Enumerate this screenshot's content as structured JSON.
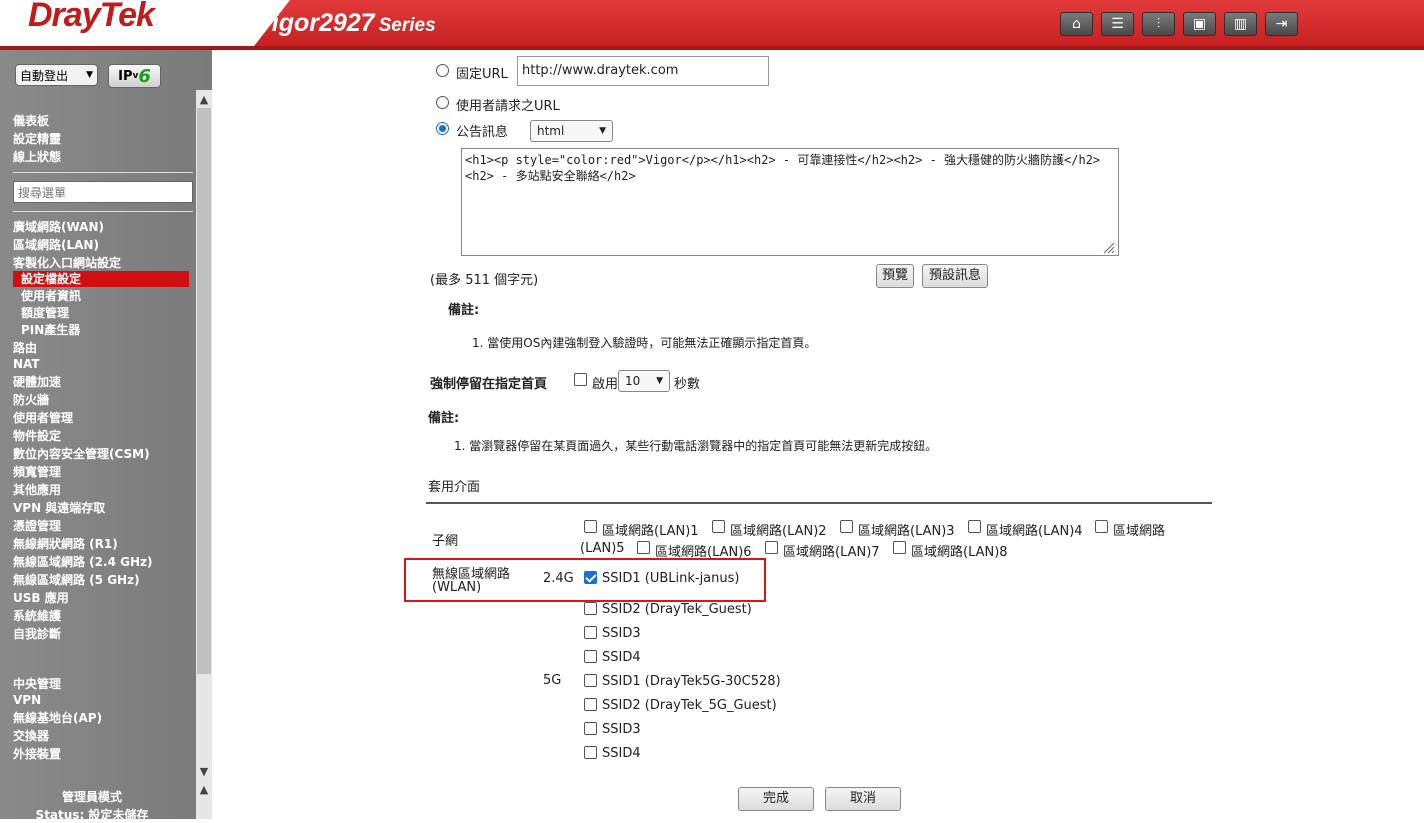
{
  "header": {
    "brand": "DrayTek",
    "model": "Vigor2927",
    "series": "Series",
    "icons": [
      "home-icon",
      "menu-icon",
      "settings-sliders-icon",
      "save-icon",
      "manual-icon",
      "logout-icon"
    ]
  },
  "sidebar": {
    "logout_select": "自動登出",
    "ipv6_prefix": "IP",
    "ipv6_v": "v",
    "ipv6_six": "6",
    "search_placeholder": "搜尋選單",
    "top_items": [
      "儀表板",
      "設定精靈",
      "線上狀態"
    ],
    "items": {
      "wan": "廣域網路(WAN)",
      "lan": "區域網路(LAN)",
      "portal": "客製化入口網站設定",
      "portal_profile": "設定檔設定",
      "portal_user": "使用者資訊",
      "portal_quota": "額度管理",
      "portal_pin": "PIN產生器",
      "routing": "路由",
      "nat": "NAT",
      "hw_accel": "硬體加速",
      "firewall": "防火牆",
      "user_mgmt": "使用者管理",
      "objects": "物件設定",
      "csm": "數位內容安全管理(CSM)",
      "bandwidth": "頻寬管理",
      "apps": "其他應用",
      "vpn_remote": "VPN 與遠端存取",
      "cert": "憑證管理",
      "wlan_r1": "無線網狀網路 (R1)",
      "wlan_24": "無線區域網路 (2.4 GHz)",
      "wlan_5": "無線區域網路 (5 GHz)",
      "usb": "USB 應用",
      "maintenance": "系統維護",
      "diagnostics": "自我診斷",
      "central": "中央管理",
      "vpn": "VPN",
      "ap": "無線基地台(AP)",
      "switch": "交換器",
      "external": "外接裝置"
    },
    "admin_mode": "管理員模式",
    "status": "Status: 設定未儲存"
  },
  "content": {
    "fixed_url_label": "固定URL",
    "fixed_url_value": "http://www.draytek.com",
    "user_url_label": "使用者請求之URL",
    "bulletin_label": "公告訊息",
    "bulletin_format": "html",
    "bulletin_text": "<h1><p style=\"color:red\">Vigor</p></h1><h2> - 可靠連接性</h2><h2> - 強大穩健的防火牆防護</h2><h2> - 多站點安全聯絡</h2>",
    "max_chars": "(最多 511 個字元)",
    "preview_btn": "預覽",
    "default_msg_btn": "預設訊息",
    "note1_title": "備註:",
    "note1_item": "1.  當使用OS內建強制登入驗證時，可能無法正確顯示指定首頁。",
    "force_stay_label": "強制停留在指定首頁",
    "enable_label": "啟用",
    "seconds_value": "10",
    "seconds_unit": "秒數",
    "note2_title": "備註:",
    "note2_item": "1. 當瀏覽器停留在某頁面過久，某些行動電話瀏覽器中的指定首頁可能無法更新完成按鈕。",
    "apply_interface": "套用介面",
    "subnet_label": "子網",
    "lan_options": [
      "區域網路(LAN)1",
      "區域網路(LAN)2",
      "區域網路(LAN)3",
      "區域網路(LAN)4",
      "區域網路",
      "(LAN)5",
      "區域網路(LAN)6",
      "區域網路(LAN)7",
      "區域網路(LAN)8"
    ],
    "wlan_label_1": "無線區域網路",
    "wlan_label_2": "(WLAN)",
    "band_24": "2.4G",
    "band_5": "5G",
    "ssid_24": [
      "SSID1 (UBLink-janus)",
      "SSID2 (DrayTek_Guest)",
      "SSID3",
      "SSID4"
    ],
    "ssid_5": [
      "SSID1 (DrayTek5G-30C528)",
      "SSID2 (DrayTek_5G_Guest)",
      "SSID3",
      "SSID4"
    ],
    "ok_btn": "完成",
    "cancel_btn": "取消"
  }
}
